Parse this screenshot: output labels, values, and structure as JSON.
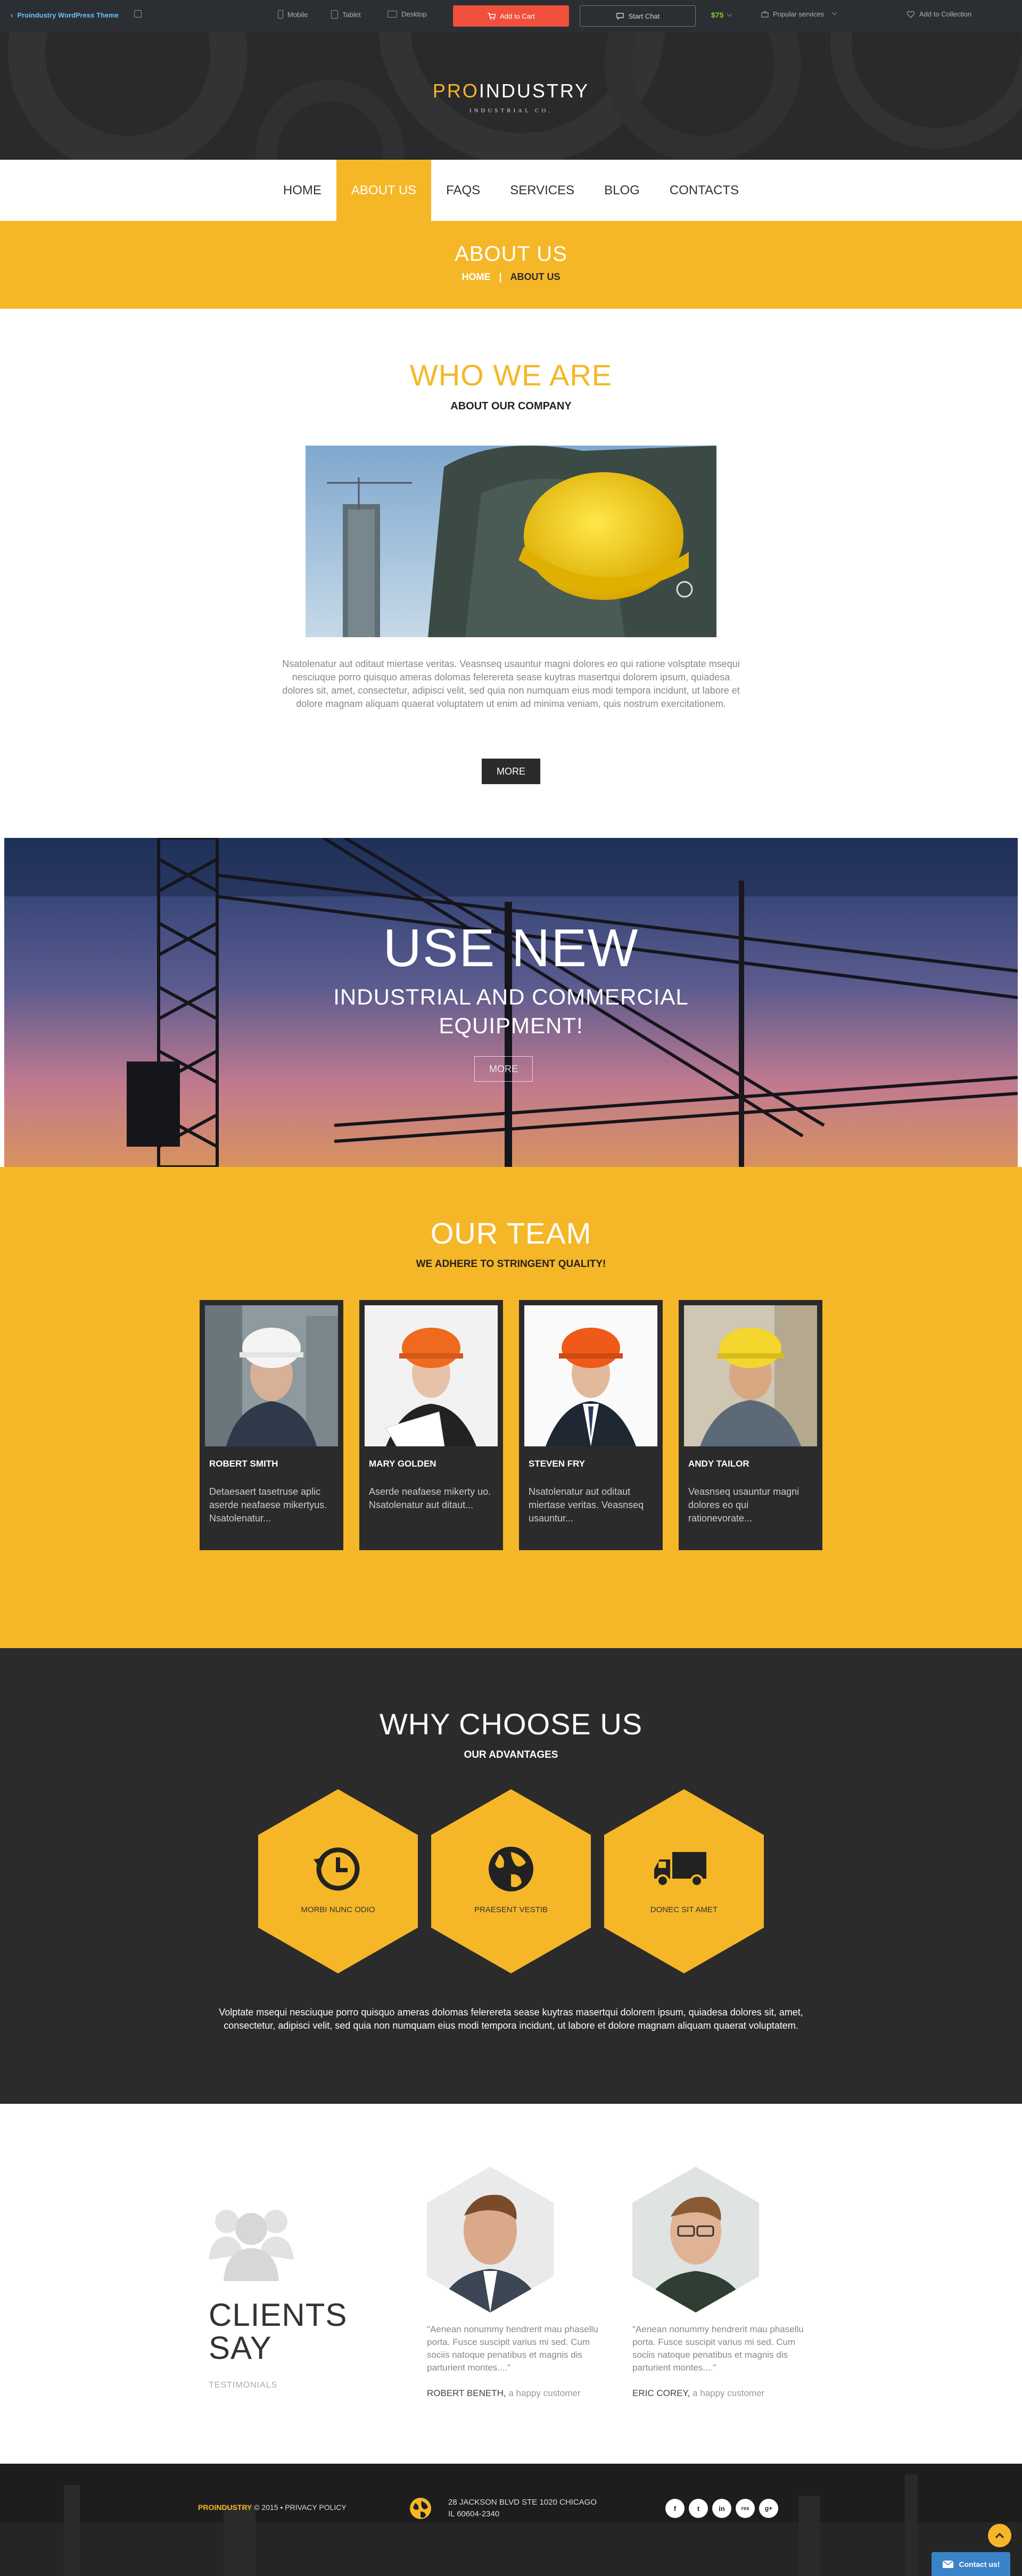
{
  "topbar": {
    "back_label": "Proindustry WordPress Theme",
    "devices": [
      "Mobile",
      "Tablet",
      "Desktop"
    ],
    "add_to_cart": "Add to Cart",
    "start_chat": "Start Chat",
    "price": "$75",
    "popular": "Popular services",
    "collection": "Add to Collection"
  },
  "header": {
    "logo_pro": "PRO",
    "logo_rest": "INDUSTRY",
    "logo_sub": "INDUSTRIAL CO."
  },
  "nav": {
    "items": [
      "HOME",
      "ABOUT US",
      "FAQS",
      "SERVICES",
      "BLOG",
      "CONTACTS"
    ],
    "active": "ABOUT US"
  },
  "page_title": {
    "title": "ABOUT US",
    "crumb_home": "HOME",
    "crumb_sep": "|",
    "crumb_current": "ABOUT US"
  },
  "who": {
    "title": "WHO WE ARE",
    "subtitle": "ABOUT OUR COMPANY",
    "text": "Nsatolenatur aut oditaut miertase veritas. Veasnseq usauntur magni dolores eo qui ratione volsptate msequi nesciuque porro quisquo ameras dolomas felerereta sease kuytras masertqui dolorem ipsum, quiadesa dolores sit, amet, consectetur, adipisci velit, sed quia non numquam eius modi tempora incidunt, ut labore et dolore magnam aliquam quaerat voluptatem ut enim ad minima veniam, quis nostrum exercitationem.",
    "button": "MORE"
  },
  "banner": {
    "title": "USE NEW",
    "subtitle_line1": "INDUSTRIAL AND COMMERCIAL",
    "subtitle_line2": "EQUIPMENT!",
    "button": "MORE"
  },
  "team": {
    "title": "OUR TEAM",
    "subtitle": "WE ADHERE TO STRINGENT QUALITY!",
    "members": [
      {
        "name": "ROBERT SMITH",
        "desc": "Detaesaert tasetruse aplic aserde neafaese mikertyus. Nsatolenatur..."
      },
      {
        "name": "MARY GOLDEN",
        "desc": "Aserde neafaese mikerty uo. Nsatolenatur aut ditaut..."
      },
      {
        "name": "STEVEN FRY",
        "desc": "Nsatolenatur aut oditaut miertase veritas. Veasnseq usauntur..."
      },
      {
        "name": "ANDY TAILOR",
        "desc": "Veasnseq usauntur magni dolores eo qui rationevorate..."
      }
    ]
  },
  "why": {
    "title": "WHY CHOOSE US",
    "subtitle": "OUR ADVANTAGES",
    "features": [
      {
        "label": "MORBI NUNC ODIO",
        "icon": "history-icon"
      },
      {
        "label": "PRAESENT VESTIB",
        "icon": "globe-icon"
      },
      {
        "label": "DONEC SIT AMET",
        "icon": "truck-icon"
      }
    ],
    "text": "Volptate msequi nesciuque porro quisquo ameras dolomas felerereta sease kuytras masertqui dolorem ipsum, quiadesa dolores sit, amet, consectetur, adipisci velit, sed quia non numquam eius modi tempora incidunt, ut labore et dolore magnam aliquam quaerat voluptatem."
  },
  "testimonials": {
    "title_line1": "CLIENTS",
    "title_line2": "SAY",
    "subtitle": "TESTIMONIALS",
    "items": [
      {
        "quote": "\"Aenean nonummy hendrerit mau phasellu porta. Fusce suscipit varius mi sed. Cum sociis natoque penatibus et magnis dis parturient montes....\"",
        "author": "ROBERT BENETH,",
        "role": " a happy customer"
      },
      {
        "quote": "\"Aenean nonummy hendrerit mau phasellu porta. Fusce suscipit varius mi sed. Cum sociis natoque penatibus et magnis dis parturient montes....\"",
        "author": "ERIC COREY,",
        "role": " a happy customer"
      }
    ]
  },
  "footer": {
    "brand": "PROINDUSTRY",
    "copyright": " © 2015 • PRIVACY POLICY",
    "address_line1": "28 JACKSON BLVD STE 1020 CHICAGO",
    "address_line2": "IL 60604-2340",
    "socials": [
      "f",
      "t",
      "in",
      "rss",
      "g+"
    ]
  },
  "widgets": {
    "contact": "Contact us!"
  },
  "colors": {
    "accent": "#f5b727",
    "dark": "#2b2b2b",
    "topbar": "#2b2f33",
    "cart": "#f0503c"
  }
}
